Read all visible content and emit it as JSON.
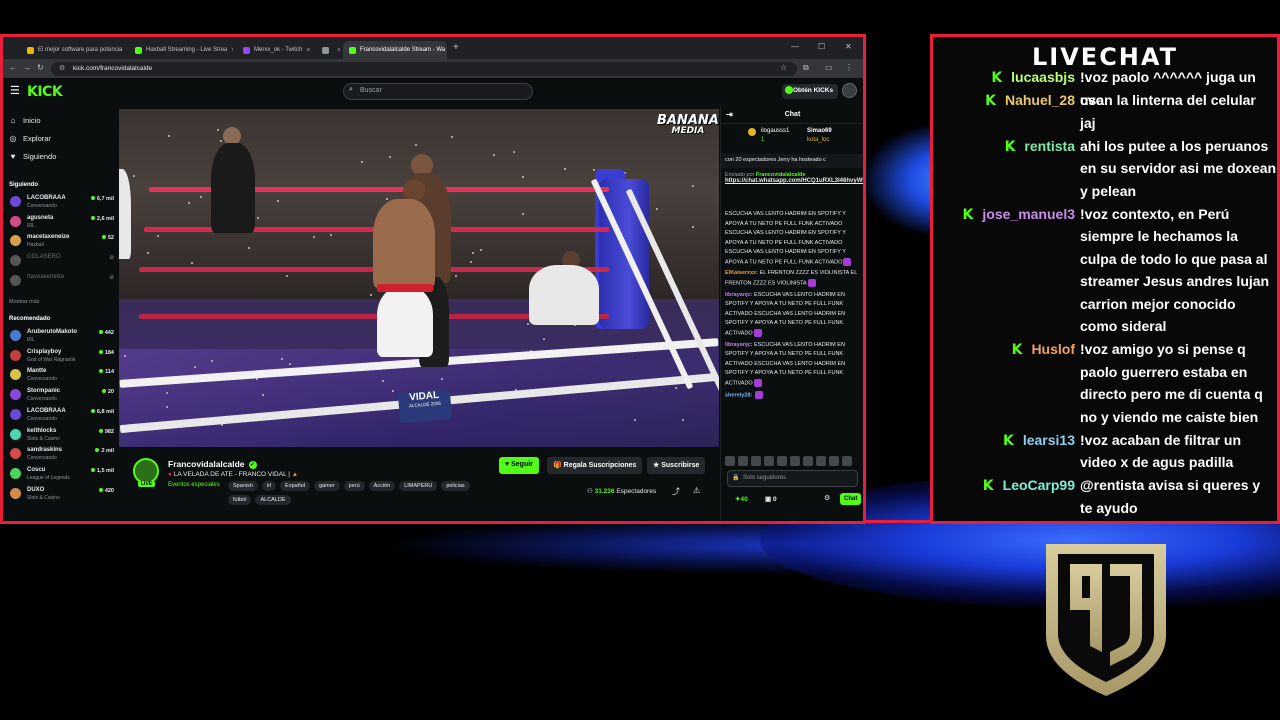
{
  "browser": {
    "tabs": [
      {
        "label": "El mejor software para potencia",
        "color": "#f4b400"
      },
      {
        "label": "Haxball Streaming - Live Strea",
        "color": "#53fc18"
      },
      {
        "label": "Merxx_ok - Twitch",
        "color": "#9146ff"
      },
      {
        "label": "",
        "color": "#8f9499"
      },
      {
        "label": "Francovidalalcalde Stream - Wa",
        "color": "#53fc18"
      }
    ],
    "url": "kick.com/francovidalalcalde"
  },
  "kick": {
    "logo": "KICK",
    "search_placeholder": "Buscar",
    "obtain_kicks": "Obtén KICKs",
    "sidebar": {
      "links": [
        "Inicio",
        "Explorar",
        "Siguiendo"
      ],
      "following_title": "Siguiendo",
      "following": [
        {
          "name": "LACOBRAAA",
          "category": "Conversando",
          "viewers": "6,7 mil",
          "color": "#6a4ad6"
        },
        {
          "name": "agusneta",
          "category": "IRL",
          "viewers": "2,6 mil",
          "color": "#d64a8a"
        },
        {
          "name": "macetaxeneize",
          "category": "Haxball",
          "viewers": "52",
          "color": "#d6a24a"
        },
        {
          "name": "GOLASERO",
          "category": "",
          "viewers": "",
          "color": "#555555"
        },
        {
          "name": "rtavoaxeneize",
          "category": "",
          "viewers": "",
          "color": "#555555"
        }
      ],
      "show_more": "Mostrar más",
      "recommended_title": "Recomendado",
      "recommended": [
        {
          "name": "AruberutoMakoto",
          "category": "IRL",
          "viewers": "442",
          "color": "#4a7ad6"
        },
        {
          "name": "Crisplayboy",
          "category": "God of War Ragnarök",
          "viewers": "184",
          "color": "#c04040"
        },
        {
          "name": "Mantte",
          "category": "Conversando",
          "viewers": "114",
          "color": "#d6c44a"
        },
        {
          "name": "Stormpanic",
          "category": "Conversando",
          "viewers": "20",
          "color": "#8a4ad6"
        },
        {
          "name": "LACOBRAAA",
          "category": "Conversando",
          "viewers": "6,8 mil",
          "color": "#6a4ad6"
        },
        {
          "name": "keithlocks",
          "category": "Slots & Casino",
          "viewers": "982",
          "color": "#4ad6b0"
        },
        {
          "name": "sandraskins",
          "category": "Conversando",
          "viewers": "2 mil",
          "color": "#d64a4a"
        },
        {
          "name": "Coscu",
          "category": "League of Legends",
          "viewers": "1,5 mil",
          "color": "#4ad65a"
        },
        {
          "name": "DUXO",
          "category": "Slots & Casino",
          "viewers": "420",
          "color": "#d68a4a"
        }
      ]
    },
    "video": {
      "overlay_logo_1": "BANANA",
      "overlay_logo_2": "MEDIA",
      "banner_text": "VIDAL",
      "banner_sub": "ALCALDE 2026"
    },
    "stream": {
      "channel": "Francovidalalcalde",
      "live_badge": "LIVE",
      "title": "LA VELADA DE ATE - FRANCO VIDAL |",
      "category": "Eventos especiales",
      "tags": [
        "Spanish",
        "irl",
        "Español",
        "gamer",
        "perú",
        "Acción",
        "LIMAPERU",
        "policias",
        "fútbol",
        "ALCALDE"
      ],
      "follow_label": "Seguir",
      "gift_label": "Regala Suscripciones",
      "subscribe_label": "Suscribirse",
      "viewers": "31.236",
      "viewers_label": "Espectadores"
    },
    "chat": {
      "title": "Chat",
      "top_gifters": [
        "ilogausss1",
        "Simao69",
        "kota_loc"
      ],
      "top_gifter_counts": [
        "1"
      ],
      "hosted_line": "20 espectadores  Jerry ha hosteado c",
      "hosted_prefix": "con",
      "pinned_label": "Enviado por",
      "pinned_user": "Francovidalalcalde",
      "pinned_link": "https://chat.whatsapp.com/HCQ1uRXL3l46hvyW9jQJMc",
      "messages": [
        {
          "user": "",
          "text": "ESCUCHA VAS LENTO HADRIM EN SPOTIFY Y APOYA A TU NETO PE FULL FUNK ACTIVADO  ESCUCHA VAS LENTO HADRIM EN SPOTIFY Y APOYA A TU NETO PE FULL FUNK ACTIVADO  ESCUCHA VAS LENTO HADRIM EN SPOTIFY Y APOYA A TU NETO PE FULL FUNK ACTIVADO"
        },
        {
          "user": "ElKaiserxxx:",
          "text": "EL FRENTON ZZZZ ES VIOLINISTA  EL FRENTON ZZZZ ES VIOLINISTA"
        },
        {
          "user": "librayanjc:",
          "text": "ESCUCHA VAS LENTO HADRIM EN SPOTIFY Y APOYA A TU NETO PE FULL FUNK ACTIVADO  ESCUCHA VAS LENTO HADRIM EN SPOTIFY Y APOYA A TU NETO PE FULL FUNK ACTIVADO"
        },
        {
          "user": "librayanjc:",
          "text": "ESCUCHA VAS LENTO HADRIM EN SPOTIFY Y APOYA A TU NETO PE FULL FUNK ACTIVADO  ESCUCHA VAS LENTO HADRIM EN SPOTIFY Y APOYA A TU NETO PE FULL FUNK ACTIVADO"
        },
        {
          "user": "sherely28:",
          "text": ""
        }
      ],
      "input_placeholder": "Solo seguidores",
      "points": "40",
      "bag_count": "0",
      "send_label": "Chat"
    }
  },
  "livechat": {
    "title": "LIVECHAT",
    "badge": "K",
    "messages": [
      {
        "user": "lucaasbjs",
        "color": "#b6ff7a",
        "lines": [
          "!voz paolo ^^^^^^ juga un cvc"
        ]
      },
      {
        "user": "Nahuel_28",
        "color": "#e8c86a",
        "lines": [
          "usan la linterna del celular",
          "jaj"
        ]
      },
      {
        "user": "rentista",
        "color": "#7ee8a8",
        "lines": [
          "ahi los putee a los peruanos",
          "en su servidor asi me doxean",
          "y pelean"
        ]
      },
      {
        "user": "jose_manuel3",
        "color": "#c88ee8",
        "lines": [
          "!voz contexto, en Perú",
          "siempre le hechamos la",
          "culpa de todo lo que pasa al",
          "streamer Jesus andres lujan",
          "carrion mejor conocido",
          "como sideral"
        ]
      },
      {
        "user": "Huslof",
        "color": "#f0a060",
        "lines": [
          "!voz amigo yo si pense q",
          "paolo guerrero estaba en",
          "directo pero me di cuenta q",
          "no y viendo me caiste bien"
        ]
      },
      {
        "user": "learsi13",
        "color": "#8ed0f0",
        "lines": [
          "!voz acaban de filtrar un",
          "video x de agus padilla"
        ]
      },
      {
        "user": "LeoCarp99",
        "color": "#7ef0d8",
        "lines": [
          "@rentista avisa si queres y",
          "te ayudo"
        ]
      }
    ]
  },
  "colors": {
    "kick_green": "#53fc18",
    "frame_red": "#e91e3a",
    "logo_gold": "#c9b98a"
  }
}
